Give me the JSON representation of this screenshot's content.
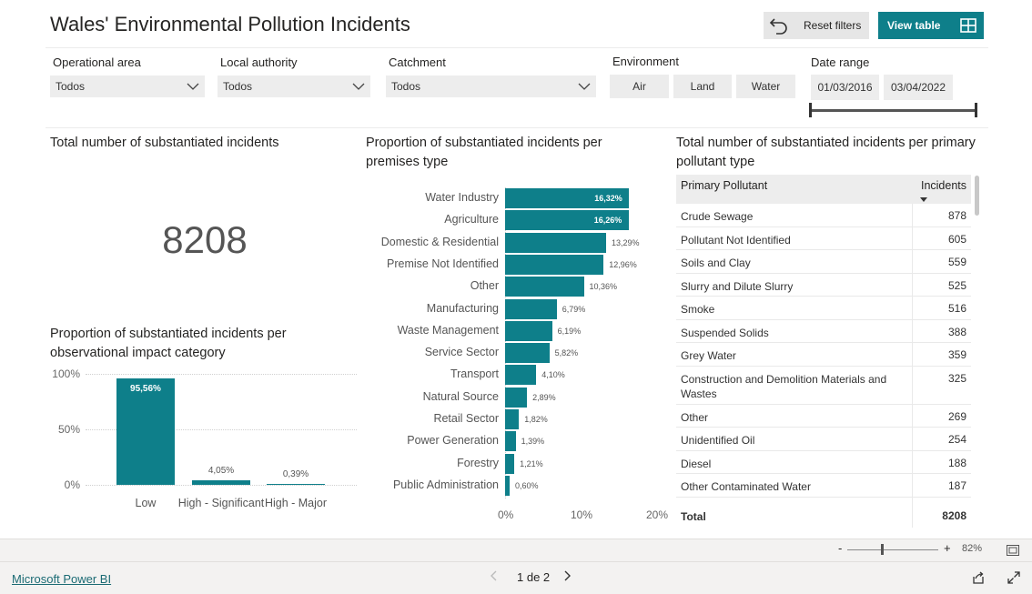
{
  "header": {
    "title": "Wales' Environmental Pollution Incidents",
    "reset_label": "Reset filters",
    "view_label": "View table",
    "colors": {
      "accent": "#0e7f8a"
    }
  },
  "filters": {
    "operational_area": {
      "label": "Operational area",
      "value": "Todos"
    },
    "local_authority": {
      "label": "Local authority",
      "value": "Todos"
    },
    "catchment": {
      "label": "Catchment",
      "value": "Todos"
    },
    "environment": {
      "label": "Environment",
      "options": [
        "Air",
        "Land",
        "Water"
      ]
    },
    "date_range": {
      "label": "Date range",
      "start": "01/03/2016",
      "end": "03/04/2022"
    }
  },
  "kpi": {
    "title": "Total number of substantiated incidents",
    "value": "8208"
  },
  "impact_chart": {
    "title": "Proportion of substantiated incidents per observational impact category",
    "yticks": [
      "100%",
      "50%",
      "0%"
    ]
  },
  "premises_chart": {
    "title": "Proportion of substantiated incidents per premises type",
    "xticks": [
      "0%",
      "10%",
      "20%"
    ]
  },
  "chart_data": [
    {
      "type": "bar",
      "title": "Proportion of substantiated incidents per observational impact category",
      "categories": [
        "Low",
        "High - Significant",
        "High - Major"
      ],
      "values": [
        95.56,
        4.05,
        0.39
      ],
      "labels": [
        "95,56%",
        "4,05%",
        "0,39%"
      ],
      "ylim": [
        0,
        100
      ],
      "grid": true
    },
    {
      "type": "bar",
      "orientation": "horizontal",
      "title": "Proportion of substantiated incidents per premises type",
      "categories": [
        "Water Industry",
        "Agriculture",
        "Domestic & Residential",
        "Premise Not Identified",
        "Other",
        "Manufacturing",
        "Waste Management",
        "Service Sector",
        "Transport",
        "Natural Source",
        "Retail Sector",
        "Power Generation",
        "Forestry",
        "Public Administration"
      ],
      "values": [
        16.32,
        16.26,
        13.29,
        12.96,
        10.36,
        6.79,
        6.19,
        5.82,
        4.1,
        2.89,
        1.82,
        1.39,
        1.21,
        0.6
      ],
      "labels": [
        "16,32%",
        "16,26%",
        "13,29%",
        "12,96%",
        "10,36%",
        "6,79%",
        "6,19%",
        "5,82%",
        "4,10%",
        "2,89%",
        "1,82%",
        "1,39%",
        "1,21%",
        "0,60%"
      ],
      "xlim": [
        0,
        20
      ]
    },
    {
      "type": "table",
      "title": "Total number of substantiated incidents per primary pollutant type",
      "columns": [
        "Primary Pollutant",
        "Incidents"
      ],
      "rows": [
        [
          "Crude Sewage",
          "878"
        ],
        [
          "Pollutant Not Identified",
          "605"
        ],
        [
          "Soils and Clay",
          "559"
        ],
        [
          "Slurry and Dilute Slurry",
          "525"
        ],
        [
          "Smoke",
          "516"
        ],
        [
          "Suspended Solids",
          "388"
        ],
        [
          "Grey Water",
          "359"
        ],
        [
          "Construction and Demolition Materials and Wastes",
          "325"
        ],
        [
          "Other",
          "269"
        ],
        [
          "Unidentified Oil",
          "254"
        ],
        [
          "Diesel",
          "188"
        ],
        [
          "Other Contaminated Water",
          "187"
        ]
      ],
      "total": [
        "Total",
        "8208"
      ]
    }
  ],
  "table": {
    "title": "Total number of substantiated incidents per primary pollutant type",
    "col1": "Primary Pollutant",
    "col2": "Incidents",
    "total_label": "Total",
    "total_value": "8208"
  },
  "statusbar": {
    "zoom": "82%",
    "minus": "-",
    "plus": "+"
  },
  "footer": {
    "link": "Microsoft Power BI",
    "page": "1 de 2"
  }
}
